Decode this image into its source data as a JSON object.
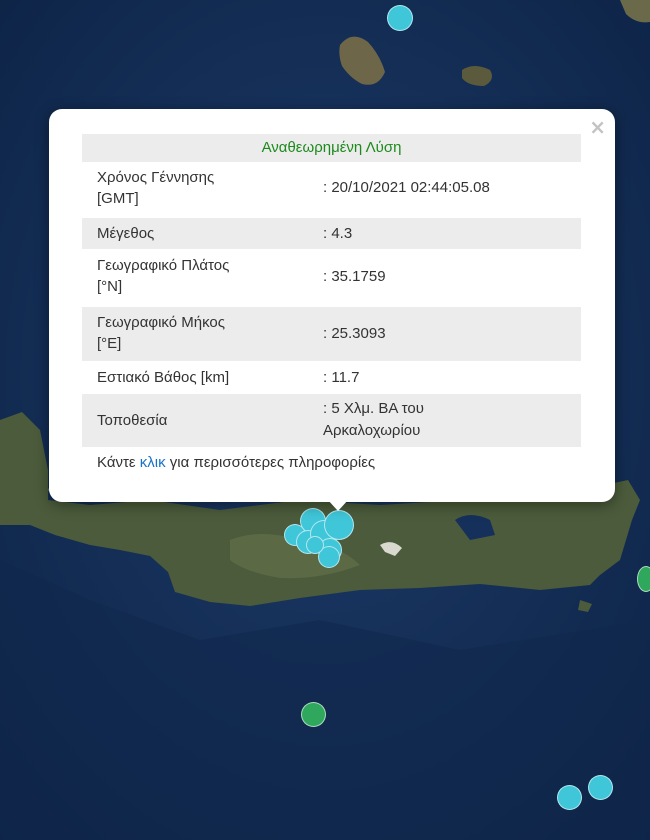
{
  "popup": {
    "title": "Αναθεωρημένη Λύση",
    "close_glyph": "×",
    "rows": [
      {
        "key_line1": "Χρόνος Γέννησης",
        "key_line2": "[GMT]",
        "value_line1": ": 20/10/2021 02:44:05.08",
        "value_line2": ""
      },
      {
        "key_line1": "Μέγεθος",
        "key_line2": "",
        "value_line1": ": 4.3",
        "value_line2": ""
      },
      {
        "key_line1": "Γεωγραφικό Πλάτος",
        "key_line2": "[°N]",
        "value_line1": ": 35.1759",
        "value_line2": ""
      },
      {
        "key_line1": "Γεωγραφικό Μήκος",
        "key_line2": "[°E]",
        "value_line1": ": 25.3093",
        "value_line2": ""
      },
      {
        "key_line1": "Εστιακό Βάθος [km]",
        "key_line2": "",
        "value_line1": ": 11.7",
        "value_line2": ""
      },
      {
        "key_line1": "Τοποθεσία",
        "key_line2": "",
        "value_line1": ": 5 Χλμ. ΒΑ του",
        "value_line2": "Αρκαλοχωρίου"
      }
    ],
    "footer_before": "Κάντε ",
    "footer_link": "κλικ",
    "footer_after": " για περισσότερες πληροφορίες"
  },
  "colors": {
    "sea": "#15305a",
    "land": "#4a5a3a",
    "marker_cyan": "#3fc6d8",
    "marker_green": "#2fa75c",
    "title_green": "#1c8a1c",
    "link_blue": "#1a73c8"
  }
}
